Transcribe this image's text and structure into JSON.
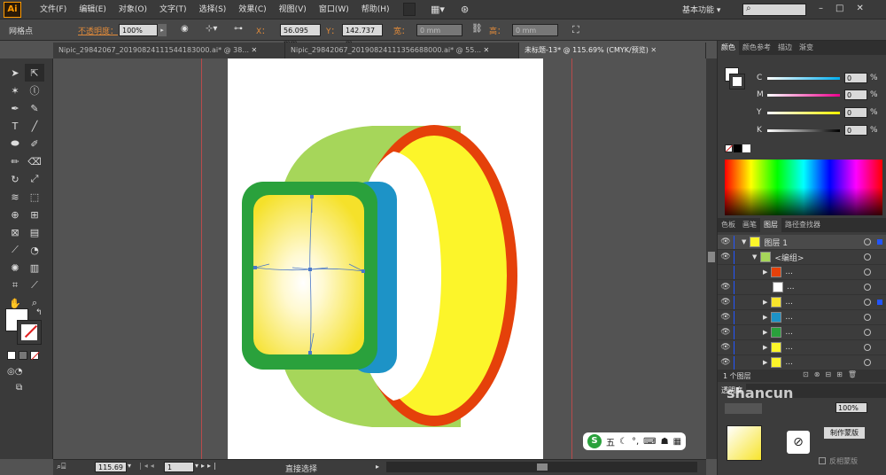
{
  "app": {
    "logo": "Ai"
  },
  "menu": [
    "文件(F)",
    "编辑(E)",
    "对象(O)",
    "文字(T)",
    "选择(S)",
    "效果(C)",
    "视图(V)",
    "窗口(W)",
    "帮助(H)"
  ],
  "workspace": {
    "label": "基本功能"
  },
  "control": {
    "mode": "网格点",
    "opacity_label": "不透明度：",
    "opacity_value": "100%",
    "x_label": "X：",
    "x_value": "56.095 mm",
    "y_label": "Y：",
    "y_value": "142.737 m",
    "w_label": "宽：",
    "w_value": "0 mm",
    "h_label": "高：",
    "h_value": "0 mm"
  },
  "tabs": [
    {
      "label": "Nipic_29842067_20190824111544183000.ai* @ 38...",
      "active": false
    },
    {
      "label": "Nipic_29842067_20190824111356688000.ai* @ 55...",
      "active": false
    },
    {
      "label": "未标题-13* @ 115.69% (CMYK/预览)",
      "active": true
    }
  ],
  "status": {
    "zoom": "115.69",
    "page": "1",
    "tool_label": "直接选择"
  },
  "color_panel": {
    "tabs": [
      "颜色",
      "颜色参考",
      "描边",
      "渐变"
    ],
    "channels": [
      {
        "label": "C",
        "value": "0",
        "unit": "%",
        "color": "#00aeef"
      },
      {
        "label": "M",
        "value": "0",
        "unit": "%",
        "color": "#ec008c"
      },
      {
        "label": "Y",
        "value": "0",
        "unit": "%",
        "color": "#fff200"
      },
      {
        "label": "K",
        "value": "0",
        "unit": "%",
        "color": "#000000"
      }
    ]
  },
  "layers_panel": {
    "tabs": [
      "色板",
      "画笔",
      "图层",
      "路径查找器"
    ],
    "rows": [
      {
        "label": "图层 1",
        "indent": 0
      },
      {
        "label": "<编组>",
        "indent": 1
      },
      {
        "label": "...",
        "indent": 2
      },
      {
        "label": "...",
        "indent": 2
      },
      {
        "label": "...",
        "indent": 2
      },
      {
        "label": "...",
        "indent": 2
      },
      {
        "label": "...",
        "indent": 2
      },
      {
        "label": "...",
        "indent": 2
      },
      {
        "label": "...",
        "indent": 2
      }
    ],
    "count": "1 个图层"
  },
  "transparency_panel": {
    "tab": "透明度",
    "opacity_value": "100%",
    "make_mask": "制作蒙版",
    "invert_mask": "反相蒙版"
  },
  "ime": {
    "label": "五"
  },
  "watermark": {
    "text": "shancun"
  },
  "colors": {
    "band": "#a6d65a",
    "ring": "#e5410a",
    "ring_fill": "#fcf52a",
    "case_side": "#1d93c7",
    "bezel": "#2aa13c",
    "screen": "#f7e42c"
  }
}
